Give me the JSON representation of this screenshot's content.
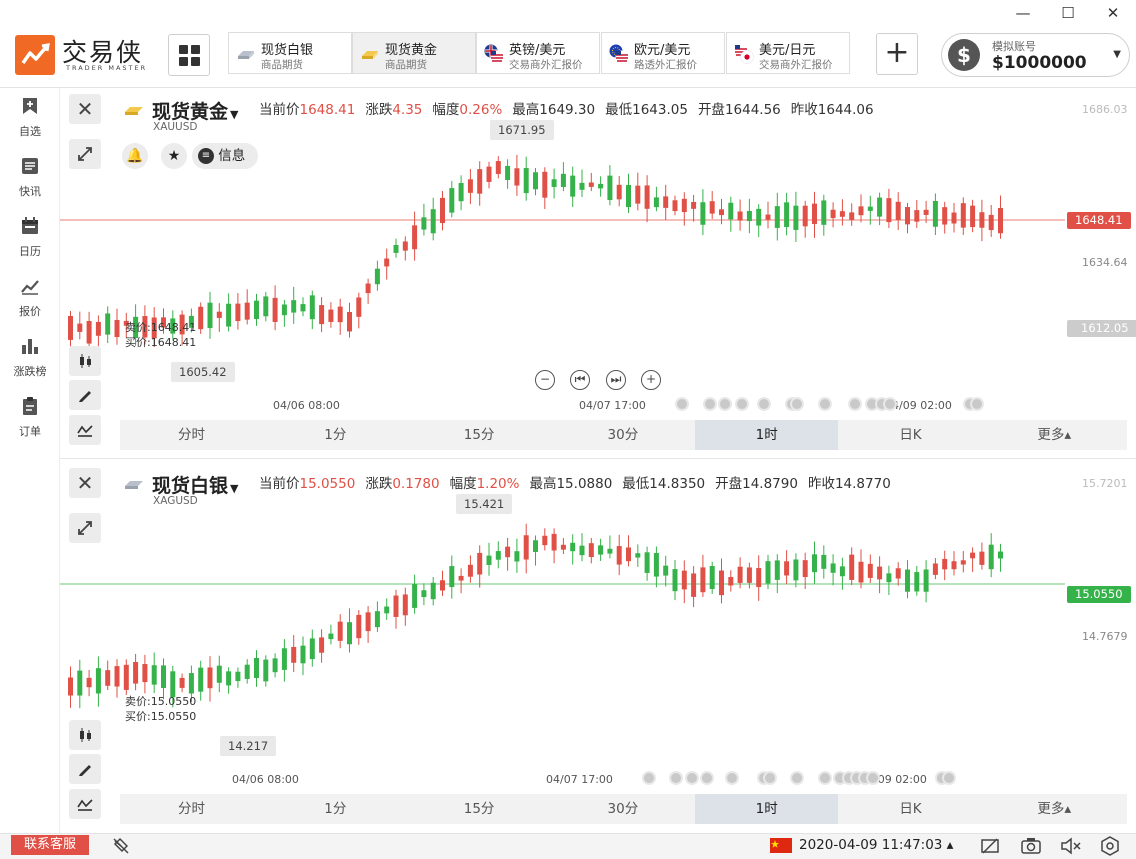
{
  "window": {
    "minimize": "—",
    "maximize": "☐",
    "close": "✕"
  },
  "logo": {
    "cn": "交易侠",
    "en": "TRADER MASTER"
  },
  "tabs": [
    {
      "name": "现货白银",
      "sub": "商品期货",
      "icon": "silver-bar-icon"
    },
    {
      "name": "现货黄金",
      "sub": "商品期货",
      "icon": "gold-bar-icon",
      "active": true
    },
    {
      "name": "英镑/美元",
      "sub": "交易商外汇报价",
      "icon": "uk-us-flag-icon"
    },
    {
      "name": "欧元/美元",
      "sub": "路透外汇报价",
      "icon": "eu-us-flag-icon"
    },
    {
      "name": "美元/日元",
      "sub": "交易商外汇报价",
      "icon": "us-jp-flag-icon"
    }
  ],
  "account": {
    "label": "模拟账号",
    "value": "$1000000"
  },
  "sidebar": [
    {
      "label": "自选",
      "icon": "bookmark-plus-icon"
    },
    {
      "label": "快讯",
      "icon": "news-icon"
    },
    {
      "label": "日历",
      "icon": "calendar-icon"
    },
    {
      "label": "报价",
      "icon": "quote-line-icon"
    },
    {
      "label": "涨跌榜",
      "icon": "bar-rank-icon"
    },
    {
      "label": "订单",
      "icon": "clipboard-icon"
    }
  ],
  "panels": [
    {
      "title": "现货黄金",
      "symbol": "XAUUSD",
      "stats": [
        {
          "k": "当前价",
          "v": "1648.41",
          "red": true
        },
        {
          "k": "涨跌",
          "v": "4.35",
          "red": true
        },
        {
          "k": "幅度",
          "v": "0.26%",
          "red": true
        },
        {
          "k": "最高",
          "v": "1649.30",
          "red": false
        },
        {
          "k": "最低",
          "v": "1643.05",
          "red": false
        },
        {
          "k": "开盘",
          "v": "1644.56",
          "red": false
        },
        {
          "k": "昨收",
          "v": "1644.06",
          "red": false
        }
      ],
      "info": "信息",
      "axis": {
        "top": "1686.03",
        "current": "1648.41",
        "mid": "1634.64",
        "low": "1612.05"
      },
      "high_callout": "1671.95",
      "low_callout": "1605.42",
      "sell": "卖价:1648.41",
      "buy": "买价:1648.41",
      "dates": [
        "04/06 08:00",
        "04/07 17:00",
        "04/09 02:00"
      ],
      "line_color": "#e05046"
    },
    {
      "title": "现货白银",
      "symbol": "XAGUSD",
      "stats": [
        {
          "k": "当前价",
          "v": "15.0550",
          "red": true
        },
        {
          "k": "涨跌",
          "v": "0.1780",
          "red": true
        },
        {
          "k": "幅度",
          "v": "1.20%",
          "red": true
        },
        {
          "k": "最高",
          "v": "15.0880",
          "red": false
        },
        {
          "k": "最低",
          "v": "14.8350",
          "red": false
        },
        {
          "k": "开盘",
          "v": "14.8790",
          "red": false
        },
        {
          "k": "昨收",
          "v": "14.8770",
          "red": false
        }
      ],
      "axis": {
        "top": "15.7201",
        "current": "15.0550",
        "mid": "14.7679"
      },
      "high_callout": "15.421",
      "low_callout": "14.217",
      "sell": "卖价:15.0550",
      "buy": "买价:15.0550",
      "dates": [
        "04/06 08:00",
        "04/07 17:00",
        "04/09 02:00"
      ],
      "line_color": "#35b34a"
    }
  ],
  "timeframes": [
    "分时",
    "1分",
    "15分",
    "30分",
    "1时",
    "日K",
    "更多▴"
  ],
  "active_timeframe": "1时",
  "statusbar": {
    "service": "联系客服",
    "datetime": "2020-04-09 11:47:03 ▴"
  },
  "colors": {
    "up": "#e05046",
    "down": "#35b34a",
    "accent": "#f06a26"
  }
}
